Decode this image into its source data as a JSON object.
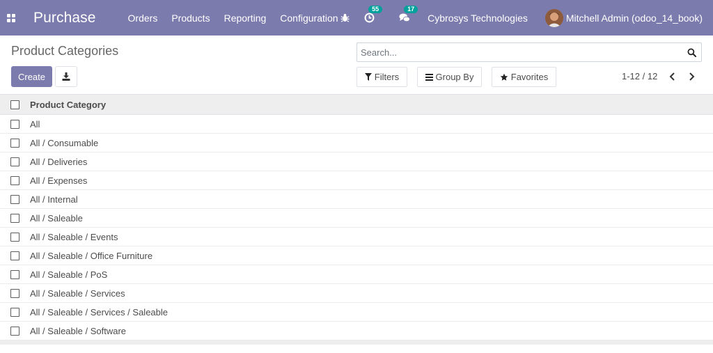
{
  "navbar": {
    "app_name": "Purchase",
    "menu": [
      "Orders",
      "Products",
      "Reporting",
      "Configuration"
    ],
    "activity_count": "55",
    "message_count": "17",
    "company": "Cybrosys Technologies",
    "user": "Mitchell Admin (odoo_14_book)"
  },
  "control": {
    "title": "Product Categories",
    "create_label": "Create",
    "search_placeholder": "Search...",
    "filters_label": "Filters",
    "groupby_label": "Group By",
    "favorites_label": "Favorites",
    "pager": "1-12 / 12"
  },
  "list": {
    "header": "Product Category",
    "rows": [
      "All",
      "All / Consumable",
      "All / Deliveries",
      "All / Expenses",
      "All / Internal",
      "All / Saleable",
      "All / Saleable / Events",
      "All / Saleable / Office Furniture",
      "All / Saleable / PoS",
      "All / Saleable / Services",
      "All / Saleable / Services / Saleable",
      "All / Saleable / Software"
    ]
  },
  "colors": {
    "brand": "#7c7bad",
    "badge": "#00a09d"
  },
  "icons": {
    "apps": "apps-grid-icon",
    "debug": "bug-icon",
    "activity": "clock-icon",
    "messages": "chat-icon",
    "download": "download-icon",
    "search": "search-icon",
    "filters": "filter-icon",
    "groupby": "bars-icon",
    "favorites": "star-icon"
  }
}
